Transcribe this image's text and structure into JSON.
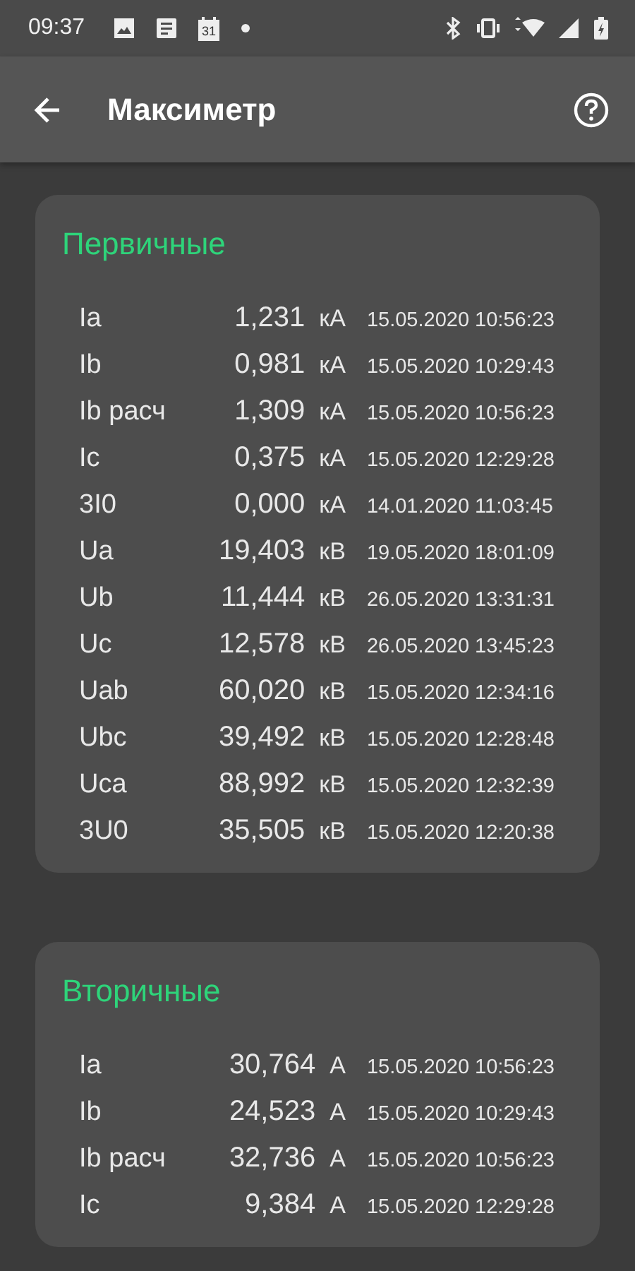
{
  "status_bar": {
    "time": "09:37",
    "calendar_day": "31"
  },
  "app_bar": {
    "title": "Максиметр"
  },
  "sections": [
    {
      "title": "Первичные",
      "rows": [
        {
          "name": "Ia",
          "value": "1,231",
          "unit": "кА",
          "date": "15.05.2020 10:56:23"
        },
        {
          "name": "Ib",
          "value": "0,981",
          "unit": "кА",
          "date": "15.05.2020 10:29:43"
        },
        {
          "name": "Ib расч",
          "value": "1,309",
          "unit": "кА",
          "date": "15.05.2020 10:56:23"
        },
        {
          "name": "Ic",
          "value": "0,375",
          "unit": "кА",
          "date": "15.05.2020 12:29:28"
        },
        {
          "name": "3I0",
          "value": "0,000",
          "unit": "кА",
          "date": "14.01.2020 11:03:45"
        },
        {
          "name": "Ua",
          "value": "19,403",
          "unit": "кВ",
          "date": "19.05.2020 18:01:09"
        },
        {
          "name": "Ub",
          "value": "11,444",
          "unit": "кВ",
          "date": "26.05.2020 13:31:31"
        },
        {
          "name": "Uc",
          "value": "12,578",
          "unit": "кВ",
          "date": "26.05.2020 13:45:23"
        },
        {
          "name": "Uab",
          "value": "60,020",
          "unit": "кВ",
          "date": "15.05.2020 12:34:16"
        },
        {
          "name": "Ubc",
          "value": "39,492",
          "unit": "кВ",
          "date": "15.05.2020 12:28:48"
        },
        {
          "name": "Uca",
          "value": "88,992",
          "unit": "кВ",
          "date": "15.05.2020 12:32:39"
        },
        {
          "name": "3U0",
          "value": "35,505",
          "unit": "кВ",
          "date": "15.05.2020 12:20:38"
        }
      ]
    },
    {
      "title": "Вторичные",
      "rows": [
        {
          "name": "Ia",
          "value": "30,764",
          "unit": "А",
          "date": "15.05.2020 10:56:23"
        },
        {
          "name": "Ib",
          "value": "24,523",
          "unit": "А",
          "date": "15.05.2020 10:29:43"
        },
        {
          "name": "Ib расч",
          "value": "32,736",
          "unit": "А",
          "date": "15.05.2020 10:56:23"
        },
        {
          "name": "Ic",
          "value": "9,384",
          "unit": "А",
          "date": "15.05.2020 12:29:28"
        }
      ]
    }
  ]
}
